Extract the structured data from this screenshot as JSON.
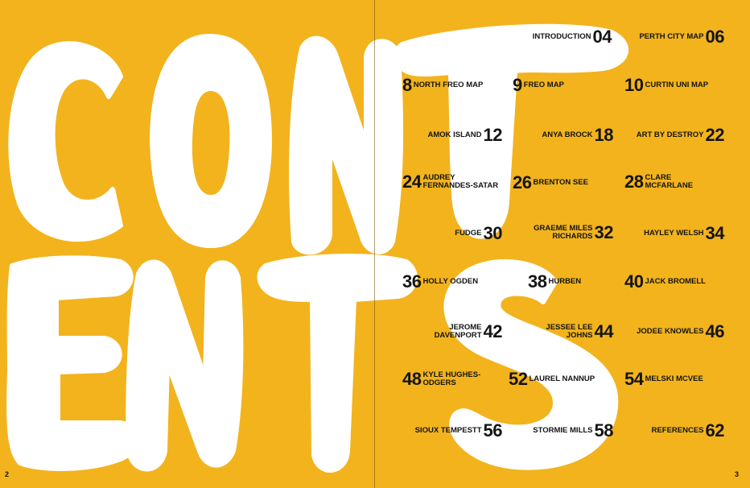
{
  "page_numbers": {
    "left": "2",
    "right": "3"
  },
  "background_color": "#f2b31d",
  "letter_color": "#ffffff",
  "title_glyph_note": "CONTENTS",
  "entries": [
    {
      "name": "INTRODUCTION",
      "page": "04"
    },
    {
      "name": "PERTH CITY MAP",
      "page": "06"
    },
    {
      "name": "NORTH FREO MAP",
      "page": "8"
    },
    {
      "name": "FREO MAP",
      "page": "9"
    },
    {
      "name": "CURTIN UNI MAP",
      "page": "10"
    },
    {
      "name": "AMOK ISLAND",
      "page": "12"
    },
    {
      "name": "ANYA BROCK",
      "page": "18"
    },
    {
      "name": "ART BY DESTROY",
      "page": "22"
    },
    {
      "name": "AUDREY\nFERNANDES-SATAR",
      "page": "24"
    },
    {
      "name": "BRENTON SEE",
      "page": "26"
    },
    {
      "name": "CLARE\nMCFARLANE",
      "page": "28"
    },
    {
      "name": "FUDGE",
      "page": "30"
    },
    {
      "name": "GRAEME MILES\nRICHARDS",
      "page": "32"
    },
    {
      "name": "HAYLEY WELSH",
      "page": "34"
    },
    {
      "name": "HOLLY OGDEN",
      "page": "36"
    },
    {
      "name": "HURBEN",
      "page": "38"
    },
    {
      "name": "JACK BROMELL",
      "page": "40"
    },
    {
      "name": "JEROME\nDAVENPORT",
      "page": "42"
    },
    {
      "name": "JESSEE LEE\nJOHNS",
      "page": "44"
    },
    {
      "name": "JODEE KNOWLES",
      "page": "46"
    },
    {
      "name": "KYLE HUGHES-\nODGERS",
      "page": "48"
    },
    {
      "name": "LAUREL NANNUP",
      "page": "52"
    },
    {
      "name": "MELSKI MCVEE",
      "page": "54"
    },
    {
      "name": "SIOUX TEMPESTT",
      "page": "56"
    },
    {
      "name": "STORMIE MILLS",
      "page": "58"
    },
    {
      "name": "REFERENCES",
      "page": "62"
    }
  ]
}
